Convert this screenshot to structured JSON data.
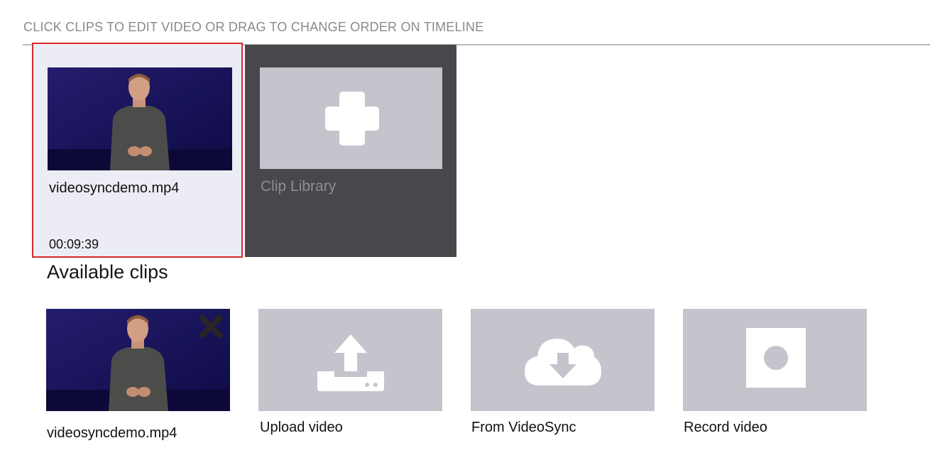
{
  "timeline": {
    "instructions": "CLICK CLIPS TO EDIT VIDEO OR DRAG TO CHANGE ORDER ON TIMELINE",
    "clip": {
      "name": "videosyncdemo.mp4",
      "duration": "00:09:39"
    },
    "library_label": "Clip Library"
  },
  "available": {
    "title": "Available clips",
    "clip": {
      "name": "videosyncdemo.mp4"
    },
    "actions": {
      "upload": "Upload video",
      "videosync": "From VideoSync",
      "record": "Record video"
    }
  },
  "icons": {
    "add": "plus-icon",
    "remove": "close-icon",
    "upload": "upload-icon",
    "download": "cloud-download-icon",
    "record": "record-icon"
  },
  "colors": {
    "selected_border": "#d42a2a",
    "tile_gray": "#c5c4cc",
    "library_dark": "#48484c",
    "thumbnail_bg": "#1a1560"
  }
}
